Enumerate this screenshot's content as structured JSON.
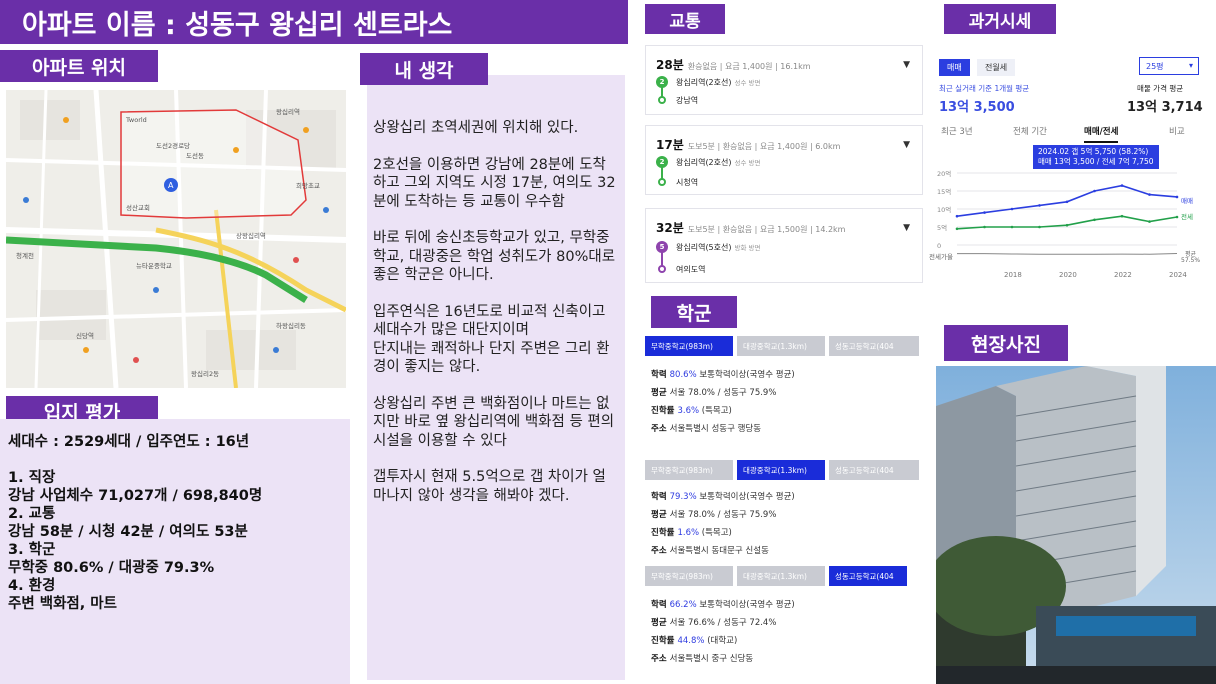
{
  "title": "아파트 이름 : 성동구 왕십리 센트라스",
  "headers": {
    "location": "아파트 위치",
    "thoughts": "내 생각",
    "evaluation": "입지 평가",
    "transit": "교통",
    "past_price": "과거시세",
    "school": "학군",
    "photo": "현장사진"
  },
  "map_labels": [
    "Tworld",
    "도선2경로당",
    "왕십리역",
    "도선동",
    "성산교회",
    "상왕십리역",
    "신당역",
    "왕십리2동",
    "뉴타운중학교",
    "청계천",
    "희망초교",
    "하왕십리동"
  ],
  "evaluation": {
    "line1": "세대수 : 2529세대 / 입주연도 : 16년",
    "line2": "1. 직장",
    "line3": "강남 사업체수 71,027개 / 698,840명",
    "line4": "2. 교통",
    "line5": "강남 58분 / 시청 42분 / 여의도 53분",
    "line6": "3. 학군",
    "line7": "무학중 80.6% / 대광중 79.3%",
    "line8": "4. 환경",
    "line9": "주변 백화점, 마트"
  },
  "thoughts": [
    "상왕십리 초역세권에 위치해 있다.",
    "2호선을 이용하면 강남에 28분에 도착하고 그외 지역도 시정 17분, 여의도 32분에 도착하는 등 교통이 우수함",
    "바로 뒤에 숭신초등학교가 있고, 무학중학교, 대광중은 학업 성취도가 80%대로 좋은 학군은 아니다.",
    "입주연식은 16년도로 비교적 신축이고 세대수가 많은 대단지이며\n단지내는 쾌적하나 단지 주변은 그리 환경이 좋지는 않다.",
    "상왕십리 주변 큰 백화점이나 마트는 없지만 바로 옆 왕십리역에 백화점 등 편의시설을 이용할 수 있다",
    "갭투자시 현재 5.5억으로 갭 차이가 얼마나지 않아 생각을 해봐야 겠다."
  ],
  "routes": [
    {
      "time": "28분",
      "meta": "환승없음 | 요금 1,400원 | 16.1km",
      "line": "2",
      "line_color": "#3bb14a",
      "from": "왕십리역(2호선)",
      "from_sub": "성수 방면",
      "to": "강남역"
    },
    {
      "time": "17분",
      "meta": "도보5분 | 환승없음 | 요금 1,400원 | 6.0km",
      "line": "2",
      "line_color": "#3bb14a",
      "from": "왕십리역(2호선)",
      "from_sub": "성수 방면",
      "to": "시청역"
    },
    {
      "time": "32분",
      "meta": "도보5분 | 환승없음 | 요금 1,500원 | 14.2km",
      "line": "5",
      "line_color": "#8e44ad",
      "from": "왕십리역(5호선)",
      "from_sub": "방화 방면",
      "to": "여의도역"
    }
  ],
  "schools": [
    {
      "tabs": [
        "무학중학교(983m)",
        "대광중학교(1.3km)",
        "성동고등학교(404"
      ],
      "active": 0,
      "rate_label": "학력",
      "rate": "80.6%",
      "rate_desc": "보통학력이상(국영수 평균)",
      "avg_label": "평균",
      "avg": "서울 78.0% / 성동구 75.9%",
      "adv_label": "진학률",
      "adv": "3.6%",
      "adv_desc": "(특목고)",
      "addr_label": "주소",
      "addr": "서울특별시 성동구 행당동"
    },
    {
      "tabs": [
        "무학중학교(983m)",
        "대광중학교(1.3km)",
        "성동고등학교(404"
      ],
      "active": 1,
      "rate_label": "학력",
      "rate": "79.3%",
      "rate_desc": "보통학력이상(국영수 평균)",
      "avg_label": "평균",
      "avg": "서울 78.0% / 성동구 75.9%",
      "adv_label": "진학률",
      "adv": "1.6%",
      "adv_desc": "(특목고)",
      "addr_label": "주소",
      "addr": "서울특별시 동대문구 신설동"
    },
    {
      "tabs": [
        "무학중학교(983m)",
        "대광중학교(1.3km)",
        "성동고등학교(404"
      ],
      "active": 2,
      "rate_label": "학력",
      "rate": "66.2%",
      "rate_desc": "보통학력이상(국영수 평균)",
      "avg_label": "평균",
      "avg": "서울 76.6% / 성동구 72.4%",
      "adv_label": "진학률",
      "adv": "44.8%",
      "adv_desc": "(대학교)",
      "addr_label": "주소",
      "addr": "서울특별시 중구 신당동"
    }
  ],
  "price_panel": {
    "tab_sale": "매매",
    "tab_rent": "전월세",
    "size_select": "25평",
    "recent_label": "최근 실거래 기준 1개월 평균",
    "recent_value": "13억 3,500",
    "ask_label": "매물 가격 평균",
    "ask_value": "13억 3,714",
    "periods": [
      "최근 3년",
      "전체 기간",
      "매매/전세",
      "비교"
    ],
    "active_period": 2,
    "tooltip_line1": "2024.02  갭 5억 5,750 (58.2%)",
    "tooltip_line2": "매매 13억 3,500 / 전세 7억 7,750",
    "legend_sale": "매매",
    "legend_jeonse": "전세",
    "gap_label": "전세가율",
    "gap_avg": "평균",
    "gap_value": "57.5%"
  },
  "chart_data": {
    "type": "line",
    "x": [
      "2016",
      "2017",
      "2018",
      "2019",
      "2020",
      "2021",
      "2022",
      "2023",
      "2024"
    ],
    "series": [
      {
        "name": "매매",
        "values": [
          8.0,
          9.0,
          10.0,
          11.0,
          12.0,
          15.0,
          16.5,
          14.0,
          13.35
        ]
      },
      {
        "name": "전세",
        "values": [
          4.5,
          5.0,
          5.0,
          5.0,
          5.5,
          7.0,
          8.0,
          6.5,
          7.775
        ]
      }
    ],
    "xticks": [
      "2018",
      "2020",
      "2022",
      "2024"
    ],
    "yticks": [
      "20억",
      "15억",
      "10억",
      "5억",
      "0"
    ],
    "ylim": [
      0,
      20
    ],
    "colors": {
      "매매": "#2b3ee0",
      "전세": "#22a04a"
    }
  }
}
